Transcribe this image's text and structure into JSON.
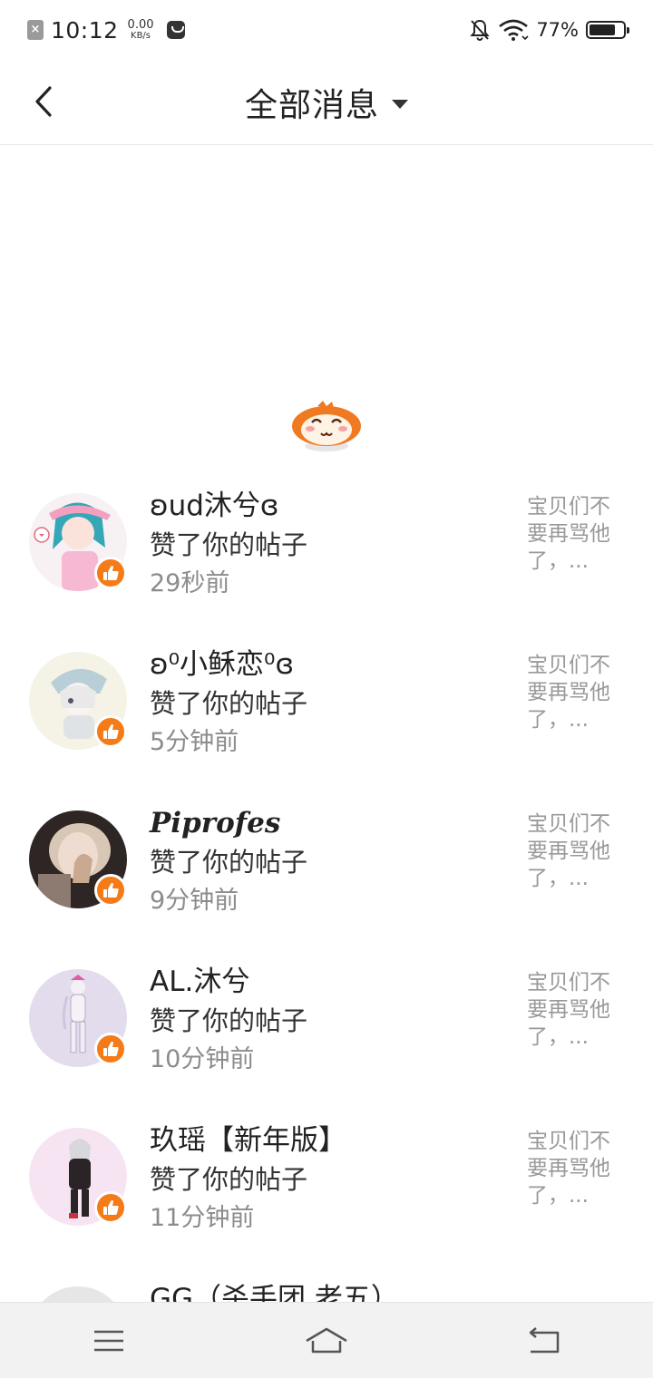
{
  "status_bar": {
    "time": "10:12",
    "net_speed_value": "0.00",
    "net_speed_unit": "KB/s",
    "battery_pct": "77%",
    "battery_level": 0.77
  },
  "header": {
    "title": "全部消息"
  },
  "messages": [
    {
      "name": "ʚud沐兮ɞ",
      "action": "赞了你的帖子",
      "time": "29秒前",
      "snippet": "宝贝们不要再骂他了，..."
    },
    {
      "name": "ʚ⁰小稣恋⁰ɞ",
      "action": "赞了你的帖子",
      "time": "5分钟前",
      "snippet": "宝贝们不要再骂他了，..."
    },
    {
      "name": "Piprofes",
      "action": "赞了你的帖子",
      "time": "9分钟前",
      "snippet": "宝贝们不要再骂他了，..."
    },
    {
      "name": "AL.沐兮",
      "action": "赞了你的帖子",
      "time": "10分钟前",
      "snippet": "宝贝们不要再骂他了，..."
    },
    {
      "name": "玖瑶【新年版】",
      "action": "赞了你的帖子",
      "time": "11分钟前",
      "snippet": "宝贝们不要再骂他了，..."
    },
    {
      "name": "GG（杀手团 老五）",
      "action": "",
      "time": "",
      "snippet": ""
    }
  ],
  "colors": {
    "accent": "#f57a18",
    "secondary_text": "#8c8c8c",
    "snippet_text": "#999999"
  },
  "icons": {
    "back": "back-arrow-icon",
    "dropdown": "caret-down-icon",
    "like": "thumbs-up-icon",
    "nav_menu": "menu-icon",
    "nav_home": "home-icon",
    "nav_back": "return-icon"
  }
}
